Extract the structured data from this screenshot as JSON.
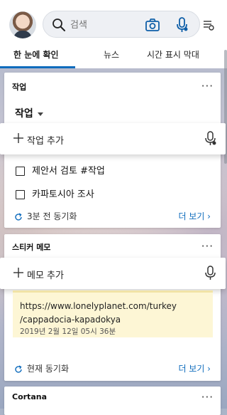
{
  "header": {
    "search_placeholder": "검색",
    "icons": [
      "avatar",
      "search-icon",
      "camera-icon",
      "microphone-icon",
      "settings-icon"
    ]
  },
  "tabs": [
    {
      "label": "한 눈에 확인",
      "active": true
    },
    {
      "label": "뉴스",
      "active": false
    },
    {
      "label": "시간 표시 막대",
      "active": false
    }
  ],
  "tasks_card": {
    "title": "작업",
    "more": "···",
    "list_selector": "작업",
    "add_label": "작업 추가",
    "items": [
      "제안서 검토 #작업",
      "카파토시아 조사"
    ],
    "sync_text": "3분 전 동기화",
    "see_more": "더 보기 ›"
  },
  "sticky_card": {
    "title": "스티커 메모",
    "more": "···",
    "add_label": "메모 추가",
    "note_url": "https://www.lonelyplanet.com/turkey/cappadocia-kapadokya",
    "note_url_line1": "https://www.lonelyplanet.com/turkey",
    "note_url_line2": "/cappadocia-kapadokya",
    "note_date": "2019년 2월 12일 05시 36분",
    "sync_text": "현재 동기화",
    "see_more": "더 보기 ›"
  },
  "cortana_card": {
    "title": "Cortana",
    "more": "···"
  },
  "colors": {
    "accent": "#0f6cbd",
    "note_background": "#fdf6d5"
  }
}
